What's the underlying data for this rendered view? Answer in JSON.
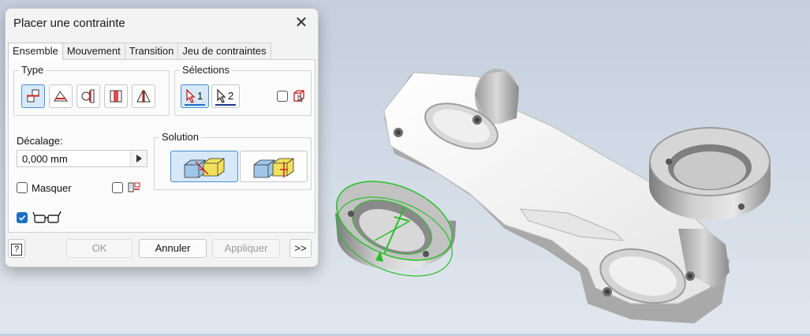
{
  "dialog": {
    "title": "Placer une contrainte",
    "close_glyph": "✕"
  },
  "tabs": [
    {
      "label": "Ensemble",
      "active": true
    },
    {
      "label": "Mouvement",
      "active": false
    },
    {
      "label": "Transition",
      "active": false
    },
    {
      "label": "Jeu de contraintes",
      "active": false
    }
  ],
  "type_group": {
    "label": "Type",
    "buttons": [
      "mate-icon",
      "angle-icon",
      "tangent-icon",
      "insert-icon",
      "symmetry-icon"
    ],
    "selected": "mate-icon"
  },
  "selections_group": {
    "label": "Sélections",
    "sel1": "1",
    "sel2": "2",
    "first_occurrence_checked": false
  },
  "offset": {
    "label": "Décalage:",
    "value": "0,000 mm"
  },
  "solution_group": {
    "label": "Solution",
    "buttons": [
      "mate-solution-icon",
      "flush-solution-icon"
    ],
    "selected": "mate-solution-icon"
  },
  "options": {
    "hide_label": "Masquer",
    "hide_checked": false,
    "predict_checked": false,
    "preview_checked": true
  },
  "footer": {
    "help": "?",
    "ok": "OK",
    "cancel": "Annuler",
    "apply": "Appliquer",
    "more": ">>"
  },
  "colors": {
    "accent": "#1a6fc4",
    "selection_highlight": "#29c029",
    "viewport_top": "#c5cfdd",
    "viewport_bottom": "#e1e7ef"
  }
}
